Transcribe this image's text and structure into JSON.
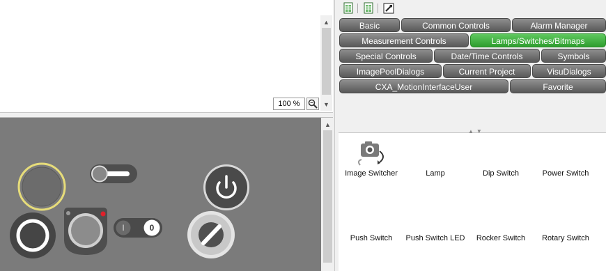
{
  "editor": {
    "zoom_value": "100 %"
  },
  "toolbox": {
    "tabs": [
      {
        "label": "Basic",
        "active": false
      },
      {
        "label": "Common Controls",
        "active": false
      },
      {
        "label": "Alarm Manager",
        "active": false
      },
      {
        "label": "Measurement Controls",
        "active": false
      },
      {
        "label": "Lamps/Switches/Bitmaps",
        "active": true
      },
      {
        "label": "Special Controls",
        "active": false
      },
      {
        "label": "Date/Time Controls",
        "active": false
      },
      {
        "label": "Symbols",
        "active": false
      },
      {
        "label": "ImagePoolDialogs",
        "active": false
      },
      {
        "label": "Current Project",
        "active": false
      },
      {
        "label": "VisuDialogs",
        "active": false
      },
      {
        "label": "CXA_MotionInterfaceUser",
        "active": false
      },
      {
        "label": "Favorite",
        "active": false
      }
    ],
    "items": [
      {
        "label": "Image Switcher",
        "icon": "image-switcher-icon"
      },
      {
        "label": "Lamp",
        "icon": "lamp-icon"
      },
      {
        "label": "Dip Switch",
        "icon": "dip-switch-icon"
      },
      {
        "label": "Power Switch",
        "icon": "power-switch-icon"
      },
      {
        "label": "Push Switch",
        "icon": "push-switch-icon"
      },
      {
        "label": "Push Switch LED",
        "icon": "push-switch-led-icon"
      },
      {
        "label": "Rocker Switch",
        "icon": "rocker-switch-icon"
      },
      {
        "label": "Rotary Switch",
        "icon": "rotary-switch-icon"
      }
    ]
  },
  "canvas": {
    "rocker_off_label": "I",
    "rocker_on_label": "0"
  },
  "colors": {
    "canvas_bg": "#7b7b7b",
    "tab_dark": "#6b6b6b",
    "tab_active": "#3faa3f",
    "lamp_ring": "#e6dc7a",
    "led_red": "#e0202a"
  }
}
